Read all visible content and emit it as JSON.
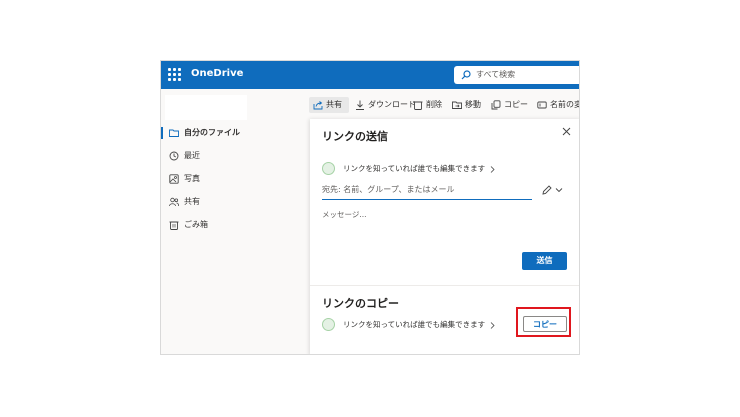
{
  "app": {
    "title": "OneDrive"
  },
  "search": {
    "placeholder": "すべて検索"
  },
  "sidebar": {
    "items": [
      {
        "label": "自分のファイル",
        "icon": "folder-icon",
        "active": true
      },
      {
        "label": "最近",
        "icon": "recent-icon"
      },
      {
        "label": "写真",
        "icon": "photo-icon"
      },
      {
        "label": "共有",
        "icon": "people-icon"
      },
      {
        "label": "ごみ箱",
        "icon": "trash-icon"
      }
    ]
  },
  "toolbar": {
    "share": "共有",
    "download": "ダウンロード",
    "delete": "削除",
    "move": "移動",
    "copy": "コピー",
    "rename": "名前の変"
  },
  "send_panel": {
    "title": "リンクの送信",
    "link_setting": "リンクを知っていれば誰でも編集できます",
    "to_placeholder": "宛先: 名前、グループ、またはメール",
    "message_placeholder": "メッセージ...",
    "send_label": "送信"
  },
  "copy_panel": {
    "title": "リンクのコピー",
    "link_setting": "リンクを知っていれば誰でも編集できます",
    "copy_label": "コピー"
  },
  "colors": {
    "brand": "#0f6cbd",
    "highlight": "#e0171e"
  }
}
